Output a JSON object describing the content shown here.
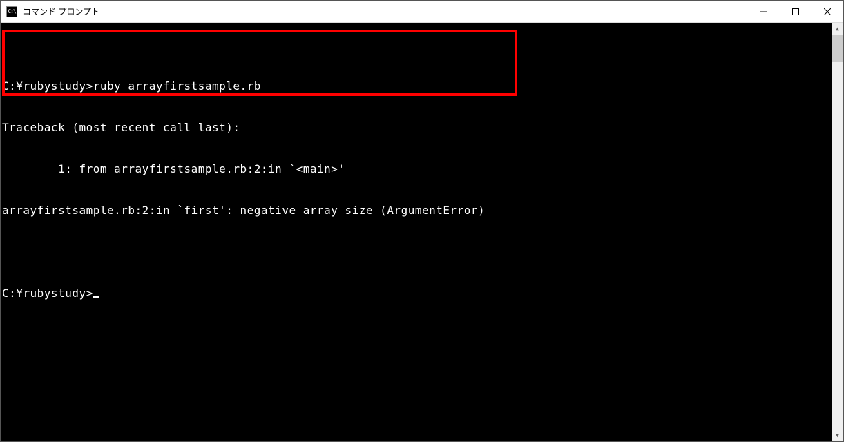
{
  "window": {
    "title": "コマンド プロンプト",
    "icon_label": "C:\\"
  },
  "annotation": {
    "highlight_color": "#ff0000"
  },
  "terminal": {
    "lines": {
      "l1_prompt": "C:¥rubystudy>",
      "l1_cmd": "ruby arrayfirstsample.rb",
      "l2": "Traceback (most recent call last):",
      "l3": "        1: from arrayfirstsample.rb:2:in `<main>'",
      "l4_a": "arrayfirstsample.rb:2:in `first': negative array size (",
      "l4_err": "ArgumentError",
      "l4_b": ")",
      "l6_prompt": "C:¥rubystudy>"
    }
  }
}
